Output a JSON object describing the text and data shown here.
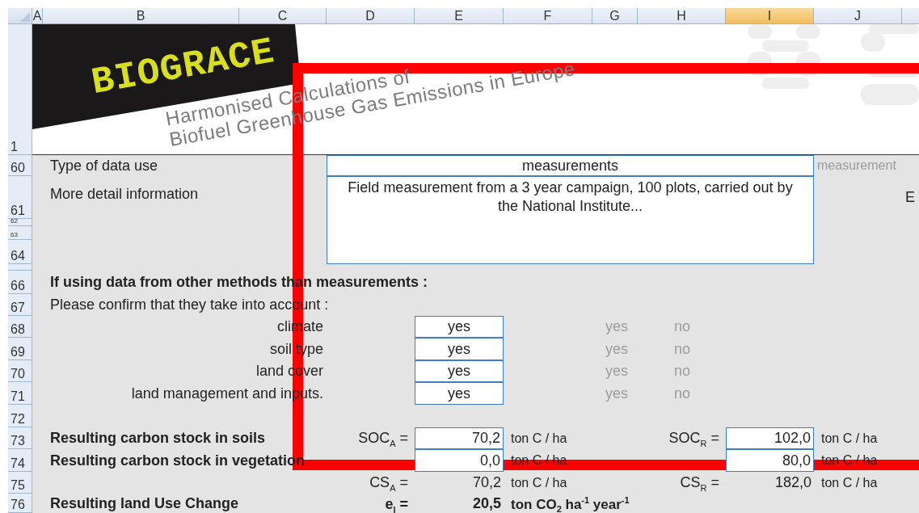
{
  "column_headers": [
    {
      "label": "A",
      "selected": false
    },
    {
      "label": "B",
      "selected": false
    },
    {
      "label": "C",
      "selected": false
    },
    {
      "label": "D",
      "selected": false
    },
    {
      "label": "E",
      "selected": false
    },
    {
      "label": "F",
      "selected": false
    },
    {
      "label": "G",
      "selected": false
    },
    {
      "label": "H",
      "selected": false
    },
    {
      "label": "I",
      "selected": true
    },
    {
      "label": "J",
      "selected": false
    }
  ],
  "row_headers": [
    "1",
    "60",
    "61",
    "62",
    "63",
    "64",
    "66",
    "67",
    "68",
    "69",
    "70",
    "71",
    "72",
    "73",
    "74",
    "75",
    "76"
  ],
  "logo": {
    "name": "BIOGRACE",
    "tagline": [
      "Harmonised Calculations of",
      "Biofuel Greenhouse Gas Emissions in Europe"
    ]
  },
  "data_use": {
    "label": "Type of data use",
    "value": "measurements",
    "hint": "measurement"
  },
  "detail": {
    "label": "More detail information",
    "value": "Field measurement from a 3 year campaign, 100 plots, carried out by the National Institute...",
    "side_text": "E"
  },
  "methods": {
    "heading": "If using data from other methods than measurements :",
    "prompt": "Please confirm that they take into account :",
    "factors": [
      {
        "label": "climate",
        "answer": "yes",
        "options": [
          "yes",
          "no"
        ]
      },
      {
        "label": "soil type",
        "answer": "yes",
        "options": [
          "yes",
          "no"
        ]
      },
      {
        "label": "land cover",
        "answer": "yes",
        "options": [
          "yes",
          "no"
        ]
      },
      {
        "label": "land management and inputs.",
        "answer": "yes",
        "options": [
          "yes",
          "no"
        ]
      }
    ]
  },
  "results": [
    {
      "label": "Resulting carbon stock in soils",
      "kind": "input",
      "actual": {
        "symbol": "SOC$_{A}$ =",
        "value": "70,2",
        "unit": "ton C / ha"
      },
      "reference": {
        "symbol": "SOC$_{R}$ =",
        "value": "102,0",
        "unit": "ton C / ha"
      }
    },
    {
      "label": "Resulting carbon stock in vegetation",
      "kind": "input",
      "actual": {
        "value": "0,0",
        "unit": "ton C / ha"
      },
      "reference": {
        "value": "80,0",
        "unit": "ton C / ha"
      }
    },
    {
      "kind": "plain",
      "actual": {
        "symbol": "CS$_{A}$ =",
        "value": "70,2",
        "unit": "ton C / ha"
      },
      "reference": {
        "symbol": "CS$_{R}$ =",
        "value": "182,0",
        "unit": "ton C / ha"
      }
    },
    {
      "label": "Resulting land Use Change",
      "kind": "total",
      "actual": {
        "symbol": "e$_{l}$ =",
        "value": "20,5",
        "unit": "ton CO$_{2}$ ha$^{-1}$ year$^{-1}$"
      }
    }
  ]
}
